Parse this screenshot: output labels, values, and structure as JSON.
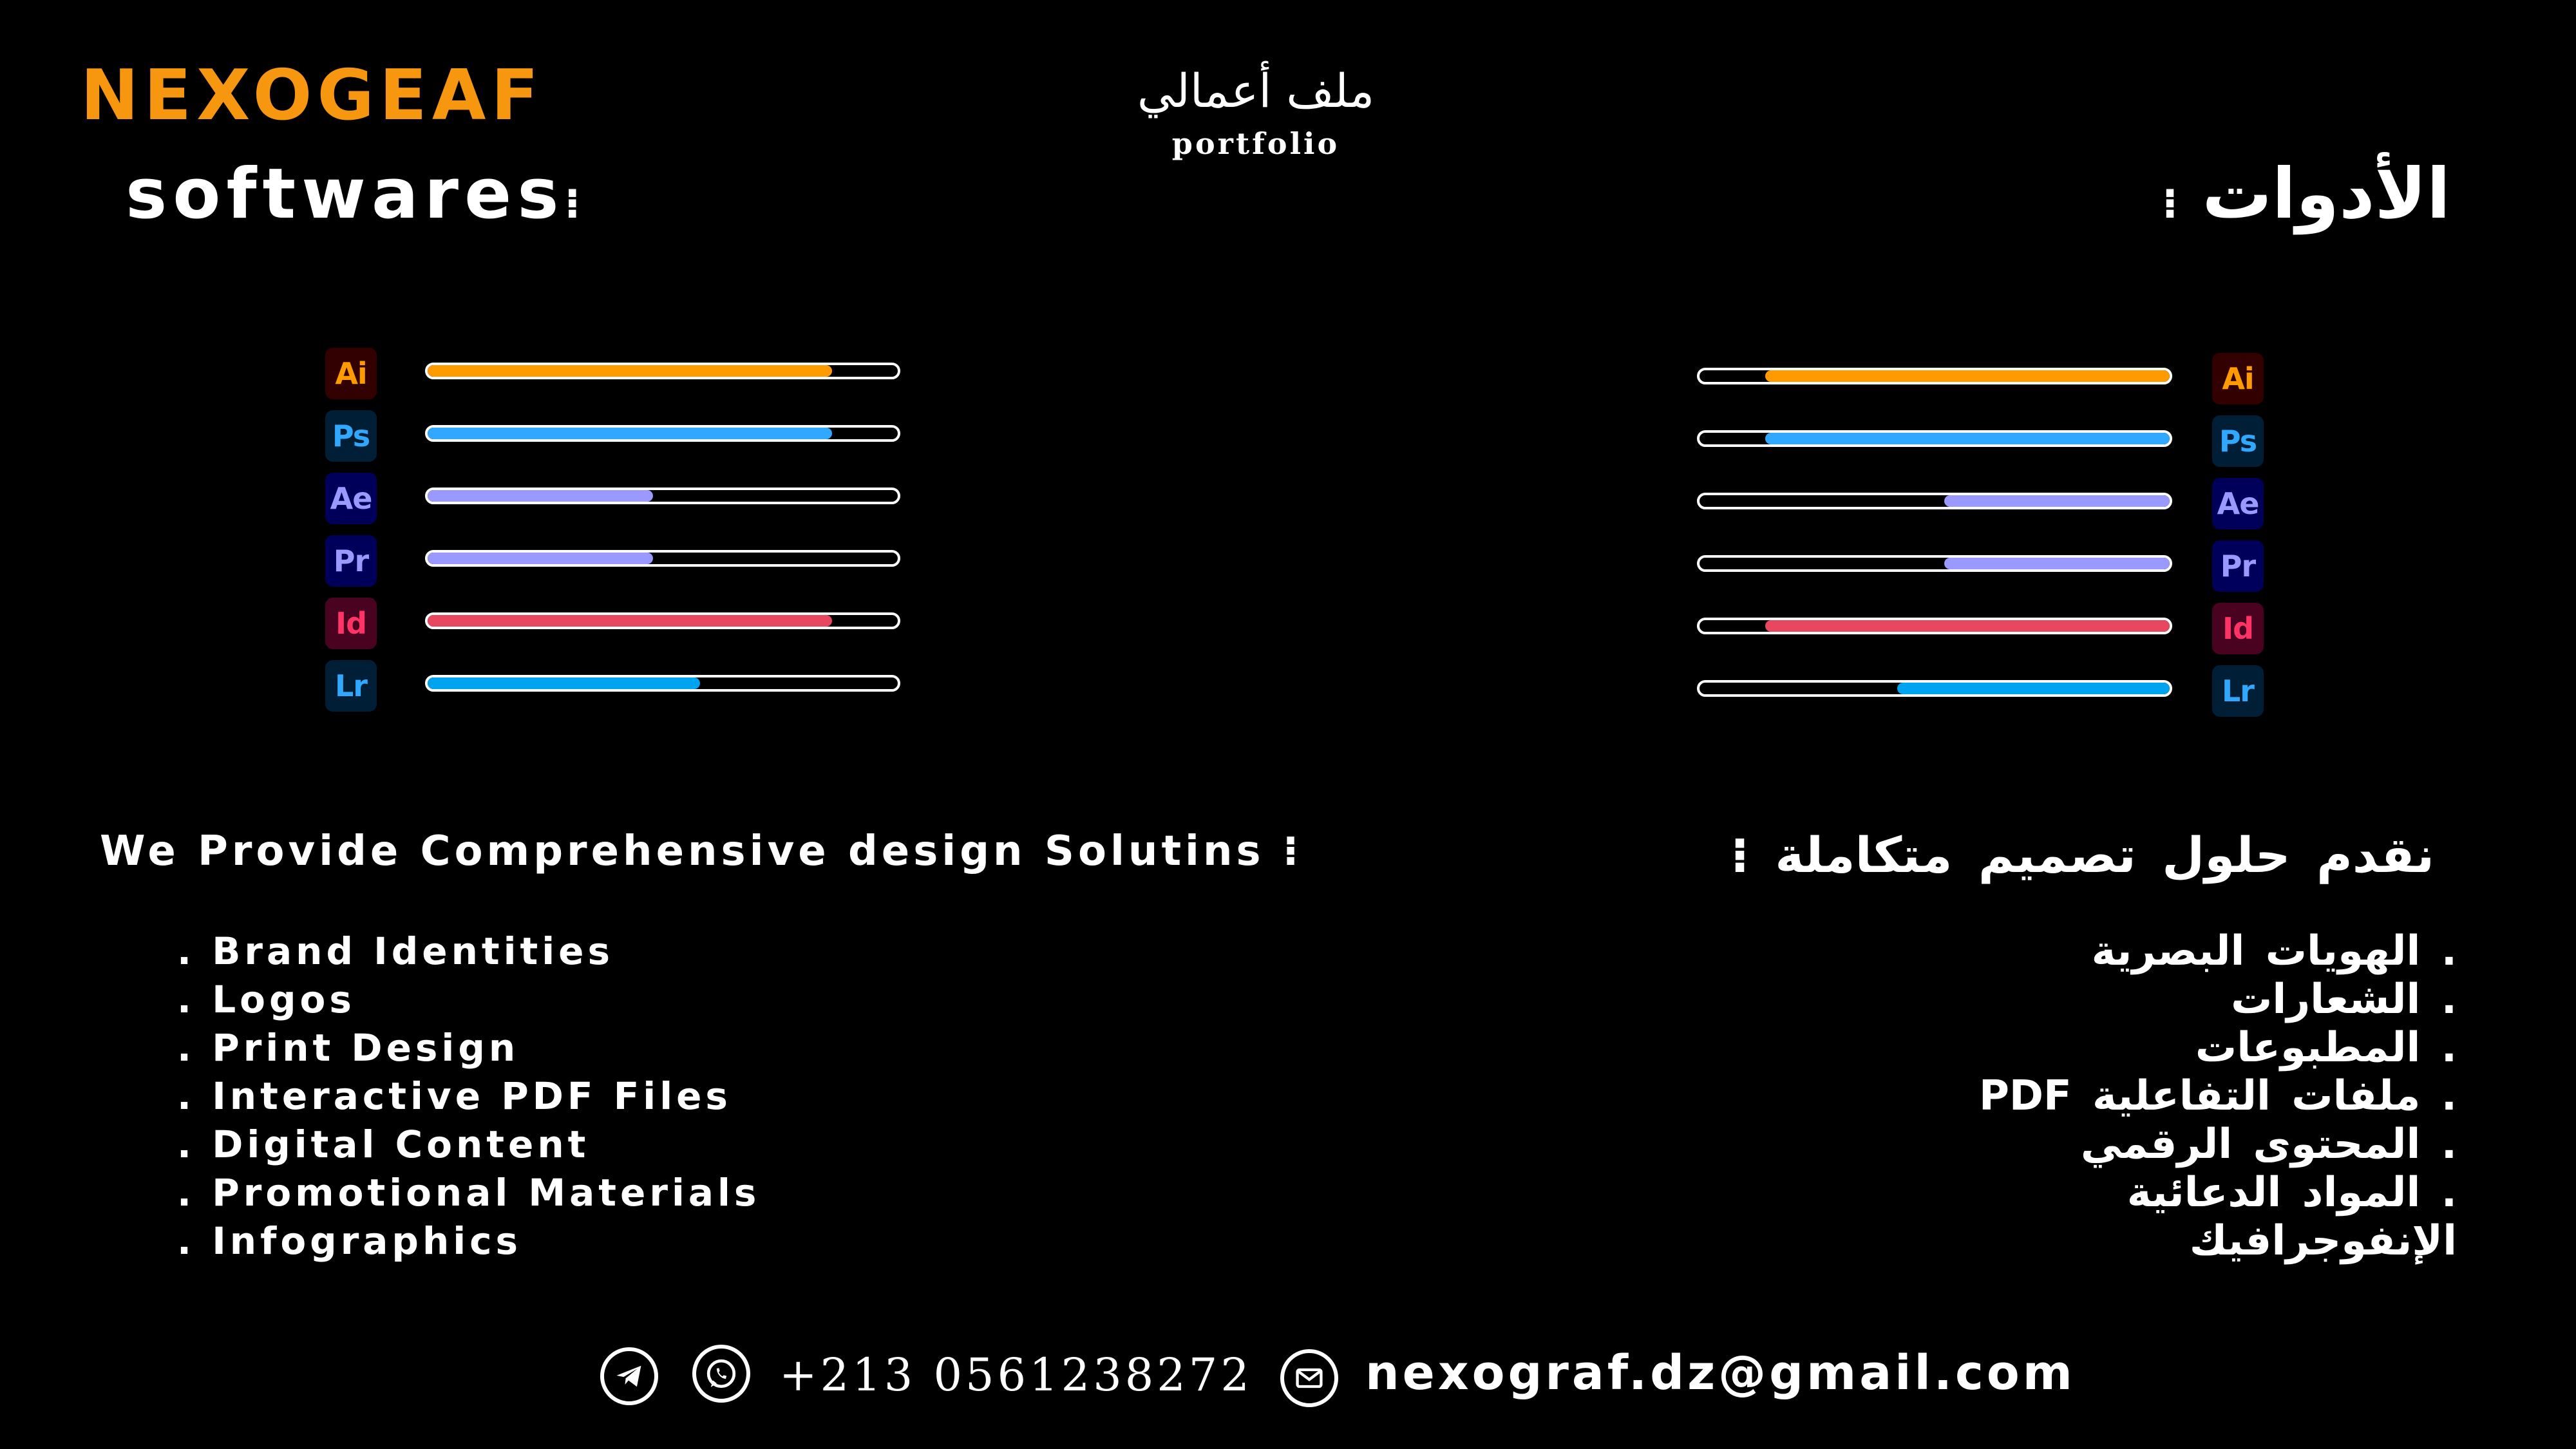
{
  "brand": {
    "name": "NEXOGEAF"
  },
  "header": {
    "title_ar": "ملف أعمالي",
    "title_en": "portfolio"
  },
  "softwares": {
    "title_en": "softwares",
    "title_ar": "الأدوات",
    "colon": "⁝",
    "left": [
      {
        "abbr": "Ai",
        "icon": "illustrator-icon",
        "level": 0.86,
        "color": "#ff9a00",
        "icon_bg": "#330000",
        "icon_fg": "#ff9a00"
      },
      {
        "abbr": "Ps",
        "icon": "photoshop-icon",
        "level": 0.86,
        "color": "#31a8ff",
        "icon_bg": "#001e36",
        "icon_fg": "#31a8ff"
      },
      {
        "abbr": "Ae",
        "icon": "after-effects-icon",
        "level": 0.48,
        "color": "#9999ff",
        "icon_bg": "#00005b",
        "icon_fg": "#9999ff"
      },
      {
        "abbr": "Pr",
        "icon": "premiere-icon",
        "level": 0.48,
        "color": "#9999ff",
        "icon_bg": "#00005b",
        "icon_fg": "#9999ff"
      },
      {
        "abbr": "Id",
        "icon": "indesign-icon",
        "level": 0.86,
        "color": "#e8475f",
        "icon_bg": "#49021f",
        "icon_fg": "#ff3366"
      },
      {
        "abbr": "Lr",
        "icon": "lightroom-icon",
        "level": 0.58,
        "color": "#00a3f0",
        "icon_bg": "#001e36",
        "icon_fg": "#31a8ff"
      }
    ],
    "right": [
      {
        "abbr": "Ai",
        "icon": "illustrator-icon",
        "level": 0.86,
        "color": "#ff9a00",
        "icon_bg": "#330000",
        "icon_fg": "#ff9a00"
      },
      {
        "abbr": "Ps",
        "icon": "photoshop-icon",
        "level": 0.86,
        "color": "#31a8ff",
        "icon_bg": "#001e36",
        "icon_fg": "#31a8ff"
      },
      {
        "abbr": "Ae",
        "icon": "after-effects-icon",
        "level": 0.48,
        "color": "#9999ff",
        "icon_bg": "#00005b",
        "icon_fg": "#9999ff"
      },
      {
        "abbr": "Pr",
        "icon": "premiere-icon",
        "level": 0.48,
        "color": "#9999ff",
        "icon_bg": "#00005b",
        "icon_fg": "#9999ff"
      },
      {
        "abbr": "Id",
        "icon": "indesign-icon",
        "level": 0.86,
        "color": "#e8475f",
        "icon_bg": "#49021f",
        "icon_fg": "#ff3366"
      },
      {
        "abbr": "Lr",
        "icon": "lightroom-icon",
        "level": 0.58,
        "color": "#00a3f0",
        "icon_bg": "#001e36",
        "icon_fg": "#31a8ff"
      }
    ]
  },
  "services": {
    "title_en": "We Provide Comprehensive design Solutins",
    "title_ar": "نقدم حلول تصميم متكاملة",
    "colon": "⁝",
    "items_en": [
      ". Brand Identities",
      ". Logos",
      ". Print Design",
      ". Interactive PDF Files",
      ". Digital Content",
      ". Promotional Materials",
      ". Infographics"
    ],
    "items_ar": [
      ". الهويات البصرية",
      ". الشعارات",
      ". المطبوعات",
      ". ملفات التفاعلية PDF",
      ". المحتوى الرقمي",
      ". المواد الدعائية",
      "الإنفوجرافيك"
    ]
  },
  "contact": {
    "phone": "+213 0561238272",
    "email": "nexograf.dz@gmail.com",
    "icons": [
      "telegram-icon",
      "whatsapp-icon",
      "mail-icon"
    ]
  },
  "colors": {
    "accent": "#f7960f",
    "background": "#000000",
    "text": "#ffffff"
  }
}
